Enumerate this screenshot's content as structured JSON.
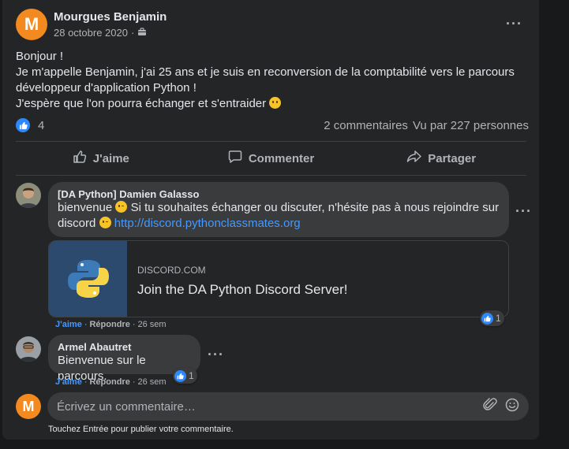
{
  "post": {
    "author": "Mourgues Benjamin",
    "author_initial": "M",
    "date": "28 octobre 2020",
    "dot": "·",
    "lines": [
      "Bonjour !",
      "Je m'appelle Benjamin, j'ai 25 ans et je suis en reconversion de la comptabilité vers le parcours",
      "développeur d'application Python !",
      "J'espère que l'on pourra échanger et s'entraider"
    ],
    "likes": "4",
    "comments_count": "2 commentaires",
    "views": "Vu par 227 personnes"
  },
  "actions": {
    "like": "J'aime",
    "comment": "Commenter",
    "share": "Partager"
  },
  "comments": [
    {
      "name": "[DA Python] Damien Galasso",
      "text_a": "bienvenue",
      "text_b": "Si tu souhaites échanger ou discuter, n'hésite pas à nous rejoindre sur",
      "text_c": "discord",
      "link": "http://discord.pythonclassmates.org",
      "preview_domain": "DISCORD.COM",
      "preview_title": "Join the DA Python Discord Server!",
      "like_label": "J'aime",
      "reply_label": "Répondre",
      "time": "26 sem",
      "reactions": "1"
    },
    {
      "name": "Armel Abautret",
      "text": "Bienvenue sur le parcours.",
      "like_label": "J'aime",
      "reply_label": "Répondre",
      "time": "26 sem",
      "reactions": "1"
    }
  ],
  "composer": {
    "placeholder": "Écrivez un commentaire…",
    "hint": "Touchez Entrée pour publier votre commentaire."
  },
  "colors": {
    "background": "#18191a",
    "card": "#242526",
    "accent": "#2d88ff",
    "avatar": "#f28a1f"
  },
  "icons": [
    "group-icon",
    "more-icon",
    "like-icon",
    "comment-icon",
    "share-icon",
    "python-logo-icon",
    "attach-icon",
    "emoji-icon"
  ]
}
